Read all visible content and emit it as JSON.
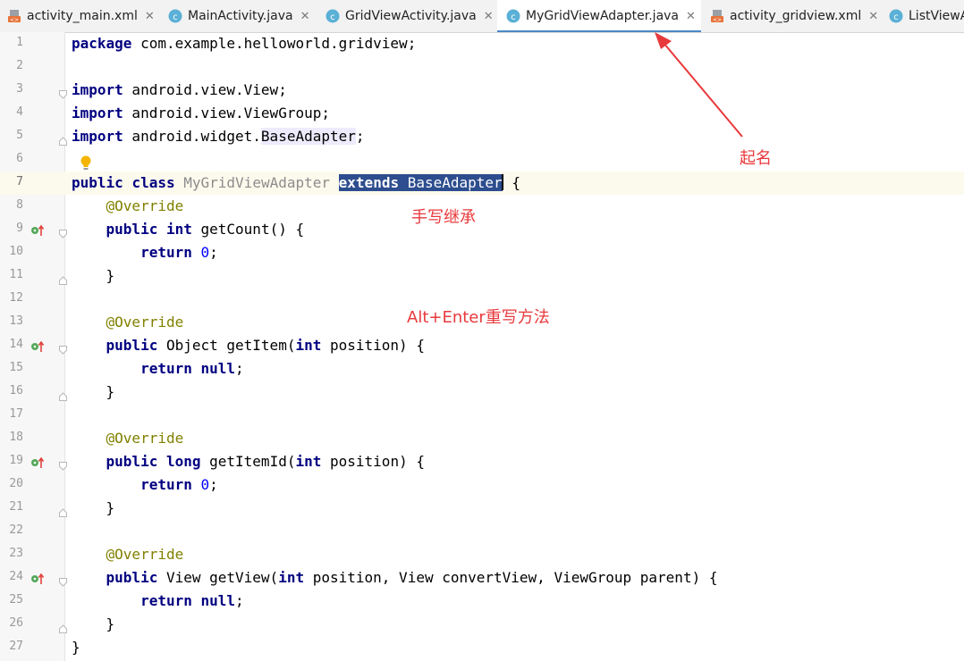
{
  "tabs": [
    {
      "label": "activity_main.xml",
      "type": "xml",
      "active": false
    },
    {
      "label": "MainActivity.java",
      "type": "class",
      "active": false
    },
    {
      "label": "GridViewActivity.java",
      "type": "class",
      "active": false
    },
    {
      "label": "MyGridViewAdapter.java",
      "type": "class",
      "active": true
    },
    {
      "label": "activity_gridview.xml",
      "type": "xml",
      "active": false
    },
    {
      "label": "ListViewA",
      "type": "class",
      "active": false
    }
  ],
  "close_glyph": "✕",
  "code": {
    "l1": {
      "num": "1",
      "a": "package",
      "b": " com.example.helloworld.gridview;"
    },
    "l2": {
      "num": "2"
    },
    "l3": {
      "num": "3",
      "a": "import",
      "b": " android.view.View;"
    },
    "l4": {
      "num": "4",
      "a": "import",
      "b": " android.view.ViewGroup;"
    },
    "l5": {
      "num": "5",
      "a": "import",
      "b": " android.widget.",
      "c": "BaseAdapter",
      "d": ";"
    },
    "l6": {
      "num": "6"
    },
    "l7": {
      "num": "7",
      "a": "public",
      "b": " ",
      "c": "class",
      "d": " ",
      "e": "MyGridViewAdapter",
      "f": " ",
      "g": "extends",
      "h": " BaseAdapter",
      "i": " {"
    },
    "l8": {
      "num": "8",
      "a": "    @Override"
    },
    "l9": {
      "num": "9",
      "a": "    ",
      "b": "public",
      "c": " ",
      "d": "int",
      "e": " getCount() {"
    },
    "l10": {
      "num": "10",
      "a": "        ",
      "b": "return",
      "c": " ",
      "d": "0",
      "e": ";"
    },
    "l11": {
      "num": "11",
      "a": "    }"
    },
    "l12": {
      "num": "12"
    },
    "l13": {
      "num": "13",
      "a": "    @Override"
    },
    "l14": {
      "num": "14",
      "a": "    ",
      "b": "public",
      "c": " Object getItem(",
      "d": "int",
      "e": " position) {"
    },
    "l15": {
      "num": "15",
      "a": "        ",
      "b": "return",
      "c": " ",
      "d": "null",
      "e": ";"
    },
    "l16": {
      "num": "16",
      "a": "    }"
    },
    "l17": {
      "num": "17"
    },
    "l18": {
      "num": "18",
      "a": "    @Override"
    },
    "l19": {
      "num": "19",
      "a": "    ",
      "b": "public",
      "c": " ",
      "d": "long",
      "e": " getItemId(",
      "f": "int",
      "g": " position) {"
    },
    "l20": {
      "num": "20",
      "a": "        ",
      "b": "return",
      "c": " ",
      "d": "0",
      "e": ";"
    },
    "l21": {
      "num": "21",
      "a": "    }"
    },
    "l22": {
      "num": "22"
    },
    "l23": {
      "num": "23",
      "a": "    @Override"
    },
    "l24": {
      "num": "24",
      "a": "    ",
      "b": "public",
      "c": " View getView(",
      "d": "int",
      "e": " position, View convertView, ViewGroup parent) {"
    },
    "l25": {
      "num": "25",
      "a": "        ",
      "b": "return",
      "c": " ",
      "d": "null",
      "e": ";"
    },
    "l26": {
      "num": "26",
      "a": "    }"
    },
    "l27": {
      "num": "27",
      "a": "}"
    }
  },
  "annotations": {
    "name": "起名",
    "extends": "手写继承",
    "override": "Alt+Enter重写方法"
  },
  "colors": {
    "annotation": "#e8393c",
    "active_tab_underline": "#4a88c7",
    "keyword": "#000080",
    "selection": "#2d4d8e"
  }
}
